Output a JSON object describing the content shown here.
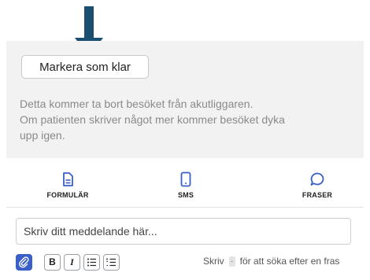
{
  "callout": {
    "color": "#1b4f72"
  },
  "visit_panel": {
    "mark_done_label": "Markera som klar",
    "info_line1": "Detta kommer ta bort besöket från akutliggaren.",
    "info_line2": "Om patienten skriver något mer kommer besöket dyka",
    "info_line3": "upp igen."
  },
  "actions": [
    {
      "label": "FORMULÄR",
      "icon": "document-icon"
    },
    {
      "label": "SMS",
      "icon": "phone-icon"
    },
    {
      "label": "FRASER",
      "icon": "speech-bubble-icon"
    }
  ],
  "composer": {
    "placeholder": "Skriv ditt meddelande här..."
  },
  "toolbar": {
    "attach_icon": "paperclip-icon",
    "bold_label": "B",
    "italic_label": "I",
    "hint_prefix": "Skriv",
    "hint_key": "-",
    "hint_suffix": "för att söka efter en fras"
  },
  "colors": {
    "accent": "#3b5fc8",
    "panel_bg": "#f2f2f2"
  }
}
